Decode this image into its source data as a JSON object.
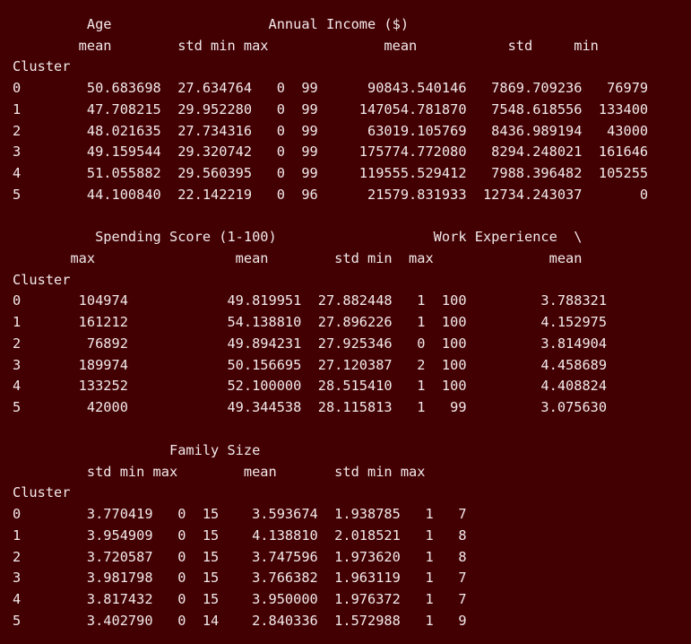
{
  "theme": {
    "background": "#430003",
    "text": "#f2eaea"
  },
  "output": {
    "block1": {
      "header1": "         Age                   Annual Income ($)",
      "header2": "        mean        std min max              mean           std     min",
      "index_name": "Cluster",
      "rows": [
        "0        50.683698  27.634764   0  99      90843.540146   7869.709236   76979",
        "1        47.708215  29.952280   0  99     147054.781870   7548.618556  133400",
        "2        48.021635  27.734316   0  99      63019.105769   8436.989194   43000",
        "3        49.159544  29.320742   0  99     175774.772080   8294.248021  161646",
        "4        51.055882  29.560395   0  99     119555.529412   7988.396482  105255",
        "5        44.100840  22.142219   0  96      21579.831933  12734.243037       0"
      ]
    },
    "block2": {
      "header1": "          Spending Score (1-100)                   Work Experience  \\",
      "header2": "       max                 mean        std min  max              mean",
      "index_name": "Cluster",
      "rows": [
        "0       104974            49.819951  27.882448   1  100         3.788321",
        "1       161212            54.138810  27.896226   1  100         4.152975",
        "2        76892            49.894231  27.925346   0  100         3.814904",
        "3       189974            50.156695  27.120387   2  100         4.458689",
        "4       133252            52.100000  28.515410   1  100         4.408824",
        "5        42000            49.344538  28.115813   1   99         3.075630"
      ]
    },
    "block3": {
      "header1": "                   Family Size",
      "header2": "         std min max        mean       std min max",
      "index_name": "Cluster",
      "rows": [
        "0        3.770419   0  15    3.593674  1.938785   1   7",
        "1        3.954909   0  15    4.138810  2.018521   1   8",
        "2        3.720587   0  15    3.747596  1.973620   1   8",
        "3        3.981798   0  15    3.766382  1.963119   1   7",
        "4        3.817432   0  15    3.950000  1.976372   1   7",
        "5        3.402790   0  14    2.840336  1.572988   1   9"
      ]
    }
  }
}
